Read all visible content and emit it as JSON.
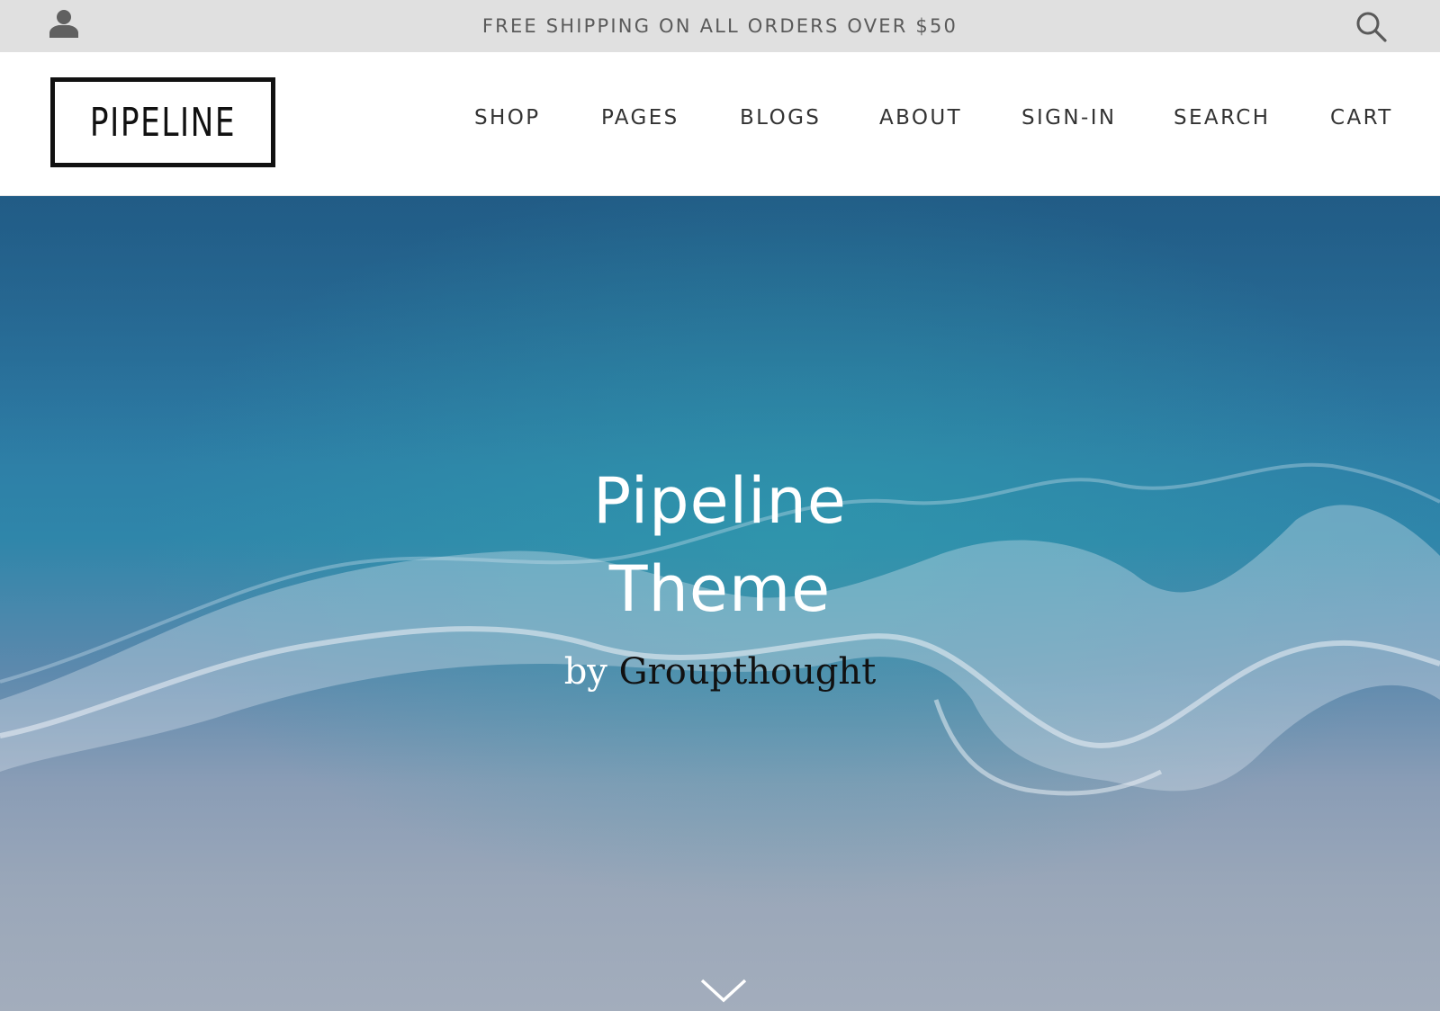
{
  "announcement": {
    "text": "FREE SHIPPING ON ALL ORDERS OVER $50",
    "account_icon": "person-icon",
    "search_icon": "search-icon"
  },
  "header": {
    "logo_text": "PIPELINE",
    "nav": [
      {
        "label": "SHOP"
      },
      {
        "label": "PAGES"
      },
      {
        "label": "BLOGS"
      },
      {
        "label": "ABOUT"
      },
      {
        "label": "SIGN-IN"
      },
      {
        "label": "SEARCH"
      },
      {
        "label": "CART"
      }
    ]
  },
  "hero": {
    "title_line1": "Pipeline",
    "title_line2": "Theme",
    "subtitle_by": "by",
    "subtitle_author": "Groupthought",
    "scroll_icon": "chevron-down-icon"
  },
  "colors": {
    "announcement_bg": "#e0e0e0",
    "ocean_deep": "#2a6b97",
    "sand": "#a3adbc"
  }
}
